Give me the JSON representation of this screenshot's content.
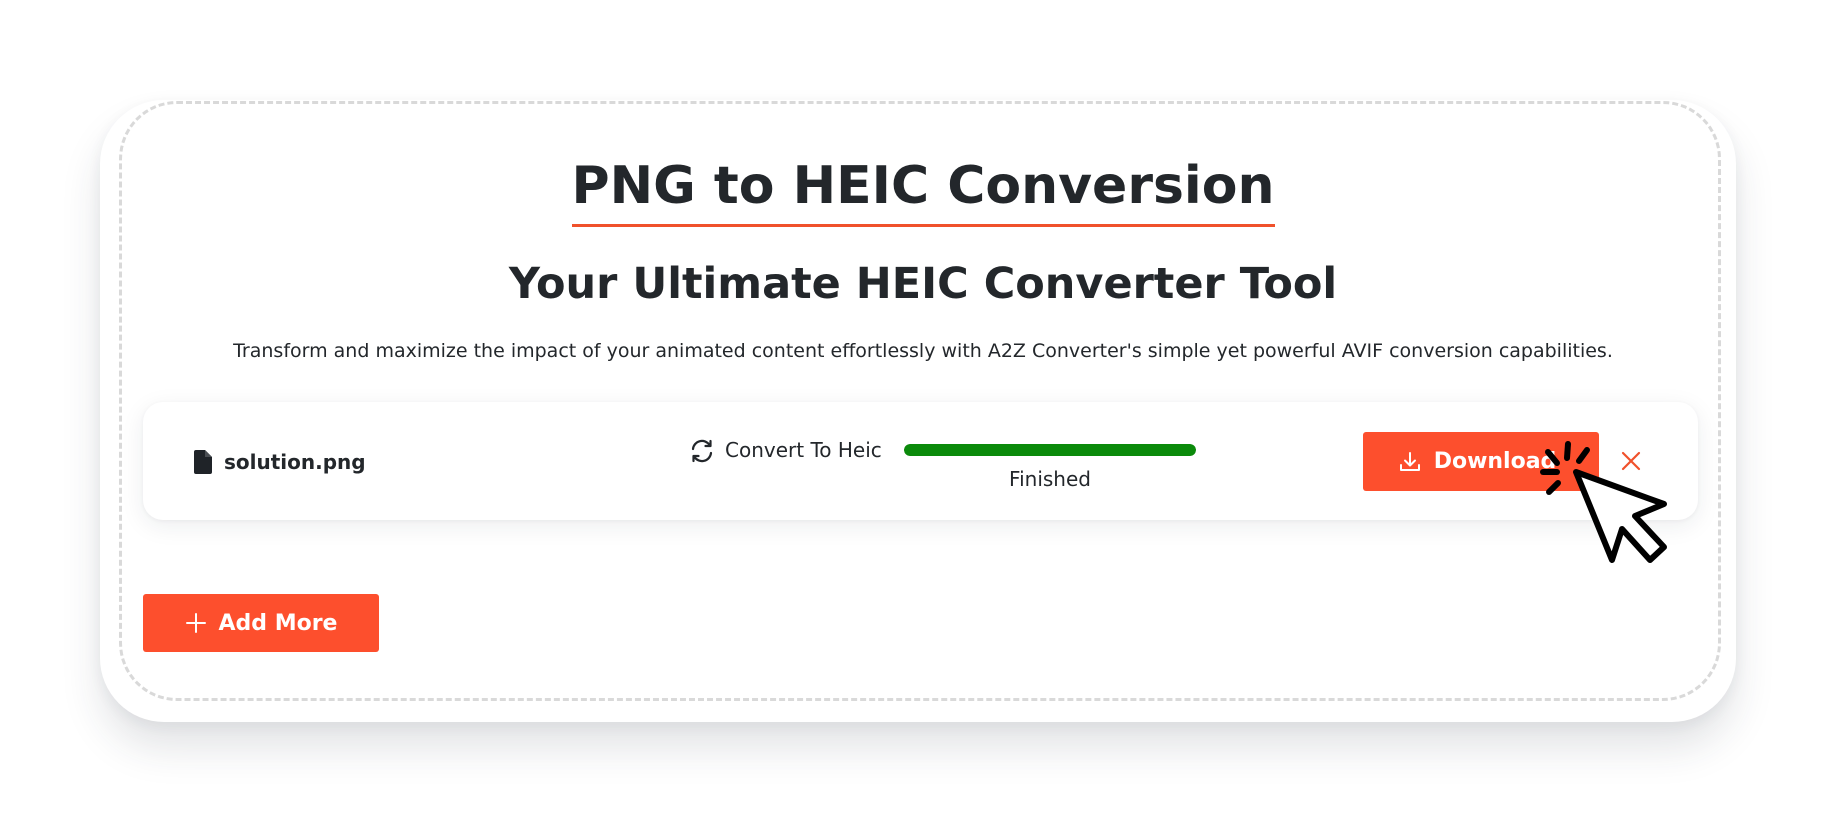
{
  "header": {
    "title": "PNG to HEIC Conversion",
    "subtitle": "Your Ultimate HEIC Converter Tool",
    "description": "Transform and maximize the impact of your animated content effortlessly with A2Z Converter's simple yet powerful AVIF conversion capabilities."
  },
  "file": {
    "name": "solution.png",
    "convert_label": "Convert To Heic",
    "progress_percent": 100,
    "status": "Finished",
    "download_label": "Download"
  },
  "actions": {
    "add_more_label": "Add More"
  },
  "icons": {
    "file": "file-icon",
    "convert": "refresh-icon",
    "download": "download-icon",
    "close": "close-icon",
    "cursor": "click-cursor-icon",
    "plus": "plus-icon"
  },
  "colors": {
    "accent": "#fd4f2d",
    "title_underline": "#f0512b",
    "progress": "#0b8a0b",
    "text": "#23272b",
    "close": "#f0512b"
  }
}
